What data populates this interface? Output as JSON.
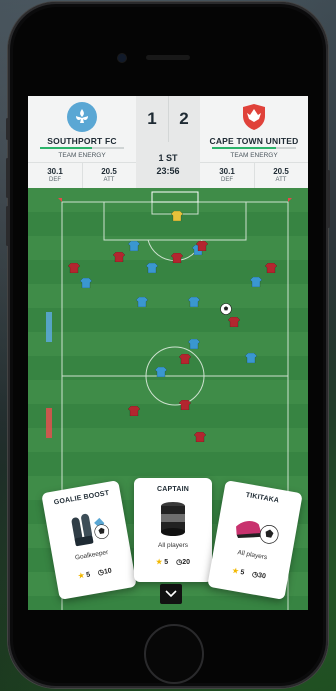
{
  "home": {
    "name": "SOUTHPORT FC",
    "subtitle": "TEAM ENERGY",
    "def_value": "30.1",
    "def_label": "DEF",
    "att_value": "20.5",
    "att_label": "ATT",
    "score": "1",
    "energy_fraction": 0.62,
    "energy_color": "#2bb36a",
    "crest_color": "#5aa7d4"
  },
  "away": {
    "name": "CAPE TOWN UNITED",
    "subtitle": "TEAM ENERGY",
    "def_value": "30.1",
    "def_label": "DEF",
    "att_value": "20.5",
    "att_label": "ATT",
    "score": "2",
    "energy_fraction": 0.76,
    "energy_color": "#2bb36a",
    "crest_color": "#e0423a"
  },
  "match": {
    "period": "1 ST",
    "clock": "23:56"
  },
  "cards": [
    {
      "title": "GOALIE BOOST",
      "subtitle": "Goalkeeper",
      "stars": "5",
      "time": "10",
      "icon": "goalkeeper-gloves-icon"
    },
    {
      "title": "CAPTAIN",
      "subtitle": "All players",
      "stars": "5",
      "time": "20",
      "icon": "captain-armband-icon"
    },
    {
      "title": "TIKITAKA",
      "subtitle": "All players",
      "stars": "5",
      "time": "30",
      "icon": "boot-and-ball-icon"
    }
  ],
  "colors": {
    "home_kit": "#3a97d0",
    "away_kit": "#b3262f",
    "keeper_kit": "#e6c23a",
    "pitch": "#3f8c48"
  },
  "icons": {
    "collapse": "chevron-down-icon",
    "star": "star-icon",
    "timer": "clock-icon"
  }
}
